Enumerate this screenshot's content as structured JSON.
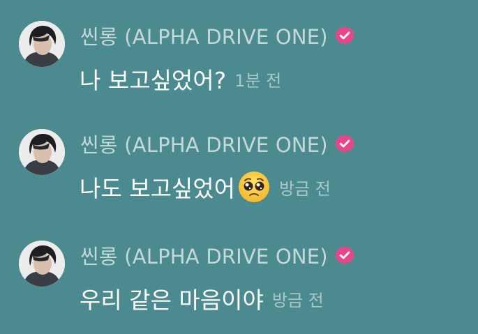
{
  "colors": {
    "background": "#4b8a8e",
    "verified_badge": "#e8458b",
    "text": "#ffffff"
  },
  "messages": [
    {
      "sender": "씬롱 (ALPHA DRIVE ONE)",
      "verified_icon": "verified-badge-icon",
      "text": "나 보고싶었어?",
      "emoji": null,
      "time": "1분 전"
    },
    {
      "sender": "씬롱 (ALPHA DRIVE ONE)",
      "verified_icon": "verified-badge-icon",
      "text": "나도 보고싶었어",
      "emoji": "pleading-face-emoji",
      "time": "방금 전"
    },
    {
      "sender": "씬롱 (ALPHA DRIVE ONE)",
      "verified_icon": "verified-badge-icon",
      "text": "우리 같은 마음이야",
      "emoji": null,
      "time": "방금 전"
    }
  ]
}
